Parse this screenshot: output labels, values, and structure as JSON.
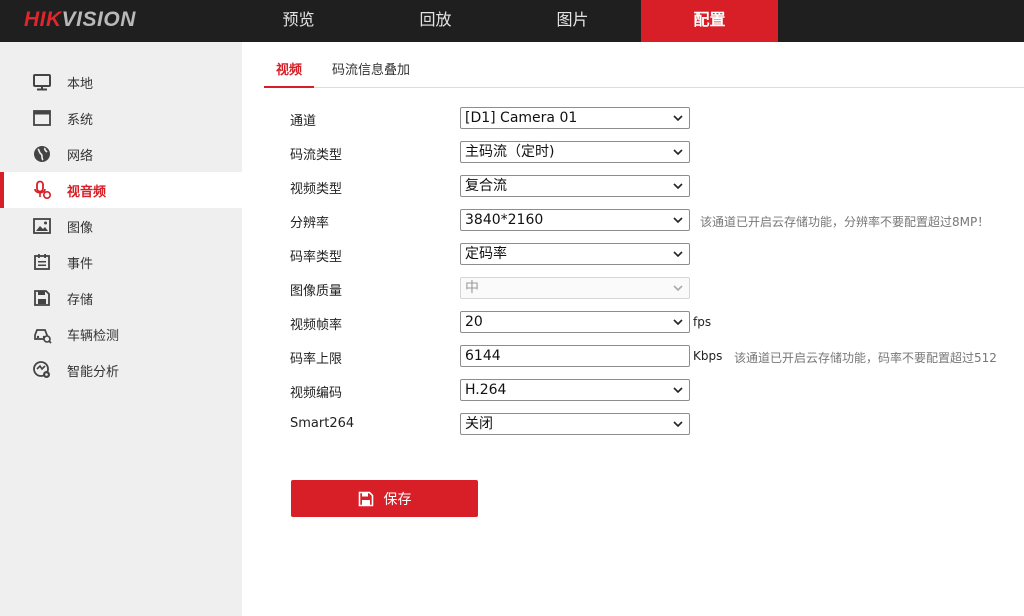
{
  "brand": {
    "part1": "HIK",
    "part2": "VISION"
  },
  "topnav": [
    {
      "label": "预览"
    },
    {
      "label": "回放"
    },
    {
      "label": "图片"
    },
    {
      "label": "配置"
    }
  ],
  "sidebar": {
    "items": [
      {
        "label": "本地",
        "icon": "monitor-icon"
      },
      {
        "label": "系统",
        "icon": "window-icon"
      },
      {
        "label": "网络",
        "icon": "globe-icon"
      },
      {
        "label": "视音频",
        "icon": "microphone-icon"
      },
      {
        "label": "图像",
        "icon": "image-icon"
      },
      {
        "label": "事件",
        "icon": "calendar-icon"
      },
      {
        "label": "存储",
        "icon": "floppy-icon"
      },
      {
        "label": "车辆检测",
        "icon": "car-icon"
      },
      {
        "label": "智能分析",
        "icon": "analysis-icon"
      }
    ]
  },
  "subtabs": [
    {
      "label": "视频"
    },
    {
      "label": "码流信息叠加"
    }
  ],
  "form": {
    "channel": {
      "label": "通道",
      "value": "[D1] Camera 01"
    },
    "stream_type": {
      "label": "码流类型",
      "value": "主码流（定时)"
    },
    "video_type": {
      "label": "视频类型",
      "value": "复合流"
    },
    "resolution": {
      "label": "分辨率",
      "value": "3840*2160",
      "note": "该通道已开启云存储功能，分辨率不要配置超过8MP！"
    },
    "bitrate_type": {
      "label": "码率类型",
      "value": "定码率"
    },
    "image_quality": {
      "label": "图像质量",
      "value": "中"
    },
    "frame_rate": {
      "label": "视频帧率",
      "value": "20",
      "unit": "fps"
    },
    "max_bitrate": {
      "label": "码率上限",
      "value": "6144",
      "unit": "Kbps",
      "note": "该通道已开启云存储功能，码率不要配置超过512"
    },
    "video_encoding": {
      "label": "视频编码",
      "value": "H.264"
    },
    "smart264": {
      "label": "Smart264",
      "value": "关闭"
    }
  },
  "save_button": {
    "label": "保存"
  },
  "colors": {
    "accent": "#d81e26",
    "topbar": "#1f1f1f",
    "sidebar": "#efefef"
  }
}
